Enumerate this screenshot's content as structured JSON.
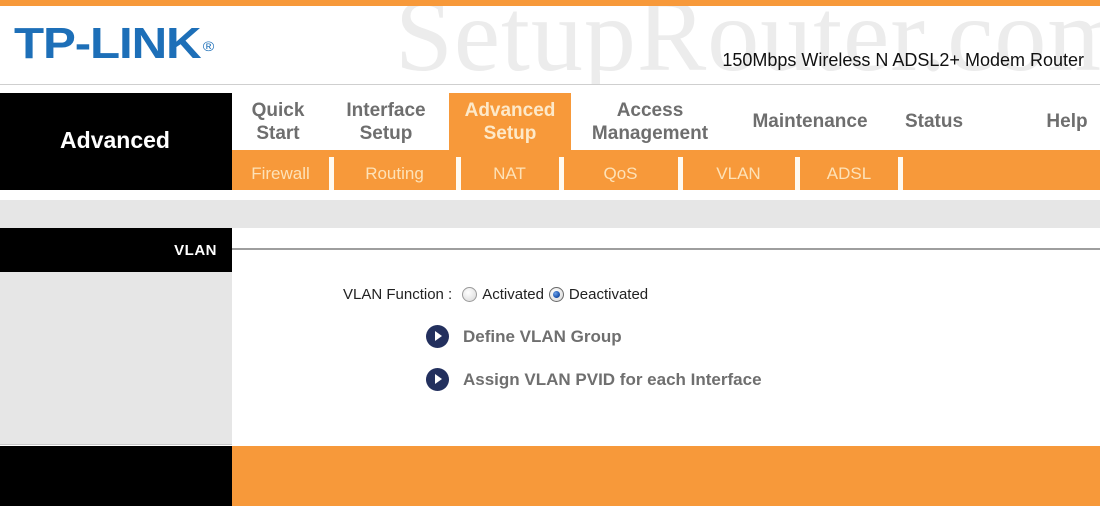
{
  "colors": {
    "accent_orange": "#f7993a",
    "logo_blue": "#1d6fb8",
    "black": "#000000",
    "panel_gray": "#e6e6e6",
    "link_icon_navy": "#23305e"
  },
  "header": {
    "logo": "TP-LINK",
    "logo_mark": "®",
    "watermark": "SetupRouter.com",
    "model": "150Mbps Wireless N ADSL2+ Modem Router"
  },
  "nav": {
    "section_title": "Advanced",
    "main_tabs": [
      {
        "line1": "Quick",
        "line2": "Start",
        "active": false
      },
      {
        "line1": "Interface",
        "line2": "Setup",
        "active": false
      },
      {
        "line1": "Advanced",
        "line2": "Setup",
        "active": true
      },
      {
        "line1": "Access",
        "line2": "Management",
        "active": false
      },
      {
        "line1": "Maintenance",
        "line2": "",
        "active": false
      },
      {
        "line1": "Status",
        "line2": "",
        "active": false
      },
      {
        "line1": "Help",
        "line2": "",
        "active": false
      }
    ],
    "sub_tabs": [
      {
        "label": "Firewall"
      },
      {
        "label": "Routing"
      },
      {
        "label": "NAT"
      },
      {
        "label": "QoS"
      },
      {
        "label": "VLAN"
      },
      {
        "label": "ADSL"
      }
    ]
  },
  "sidebar": {
    "heading": "VLAN"
  },
  "content": {
    "vlan_function_label": "VLAN Function :",
    "options": [
      {
        "label": "Activated",
        "checked": false
      },
      {
        "label": "Deactivated",
        "checked": true
      }
    ],
    "links": [
      {
        "icon": "play-circle-icon",
        "label": "Define VLAN Group"
      },
      {
        "icon": "play-circle-icon",
        "label": "Assign VLAN PVID for each Interface"
      }
    ]
  }
}
